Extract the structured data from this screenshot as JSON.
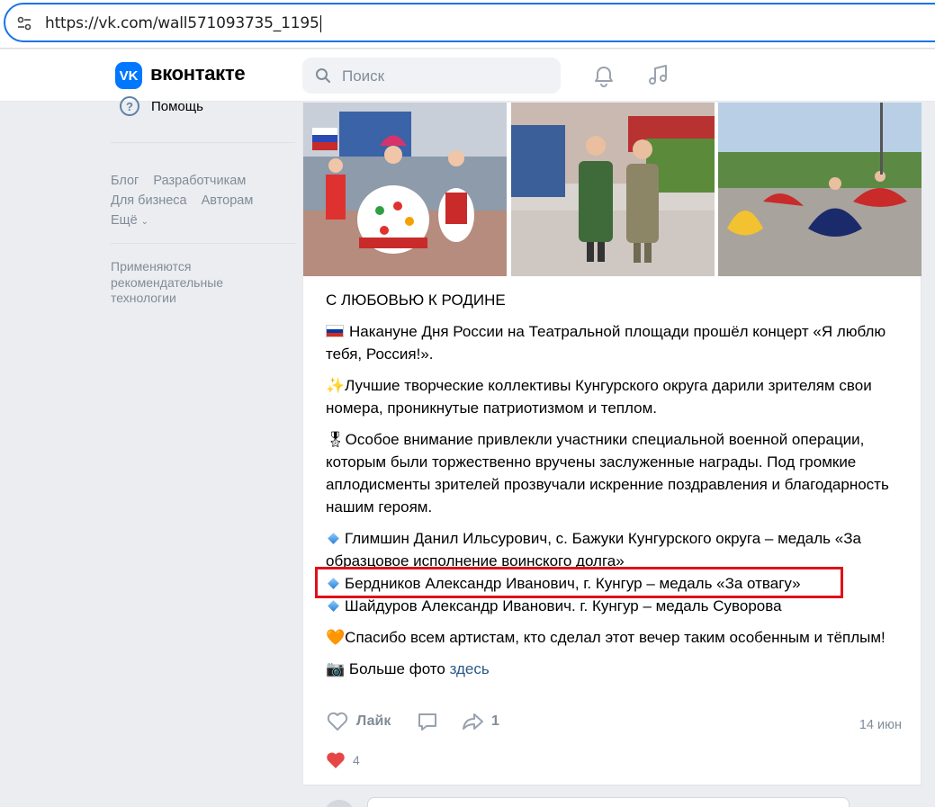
{
  "browser": {
    "url": "https://vk.com/wall571093735_1195"
  },
  "header": {
    "logo_letters": "VK",
    "wordmark": "вконтакте",
    "search_placeholder": "Поиск"
  },
  "sidebar": {
    "help_label": "Помощь",
    "links_row1": [
      "Блог",
      "Разработчикам"
    ],
    "links_row2": [
      "Для бизнеса",
      "Авторам"
    ],
    "more_label": "Ещё",
    "note": "Применяются рекомендательные технологии"
  },
  "post": {
    "title": "С ЛЮБОВЬЮ К РОДИНЕ",
    "p1": "Накануне Дня России на Театральной площади прошёл концерт «Я люблю тебя, Россия!».",
    "p2_emoji": "✨",
    "p2": "Лучшие творческие коллективы Кунгурского округа дарили зрителям свои номера, проникнутые патриотизмом и теплом.",
    "p3_emoji": "🎖",
    "p3": "Особое внимание привлекли участники специальной военной операции, которым были торжественно вручены заслуженные награды. Под громкие аплодисменты зрителей прозвучали искренние поздравления и благодарность нашим героям.",
    "awards": [
      "Глимшин Данил Ильсурович, с. Бажуки Кунгурского округа – медаль «За образцовое исполнение воинского долга»",
      "Бердников Александр Иванович, г. Кунгур – медаль «За отвагу»",
      "Шайдуров Александр Иванович. г. Кунгур – медаль Суворова"
    ],
    "p4_emoji": "🧡",
    "p4": "Спасибо всем артистам, кто сделал этот вечер таким особенным и тёплым!",
    "p5_emoji": "📷",
    "p5": "Больше фото ",
    "p5_link": "здесь",
    "like_label": "Лайк",
    "share_count": "1",
    "date": "14 июн",
    "reaction_count": "4"
  },
  "colors": {
    "vk_blue": "#0077ff",
    "highlight_red": "#e0101a",
    "link": "#2a5885",
    "muted": "#818c99"
  }
}
